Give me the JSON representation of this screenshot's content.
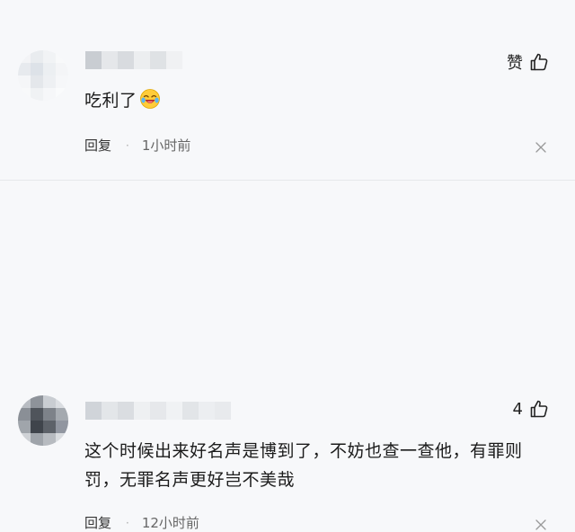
{
  "comments": [
    {
      "text": "吃利了",
      "emoji": "laughing-crying-emoji",
      "like_label": "赞",
      "reply_label": "回复",
      "separator": "·",
      "time": "1小时前"
    },
    {
      "text": "这个时候出来好名声是博到了，不妨也查一查他，有罪则罚，无罪名声更好岂不美哉",
      "like_count": "4",
      "reply_label": "回复",
      "separator": "·",
      "time": "12小时前"
    }
  ],
  "icons": {
    "like": "thumbs-up-icon",
    "close": "close-icon"
  },
  "colors": {
    "background": "#f7f8fa",
    "text": "#1b1b1b",
    "muted": "#666666"
  }
}
